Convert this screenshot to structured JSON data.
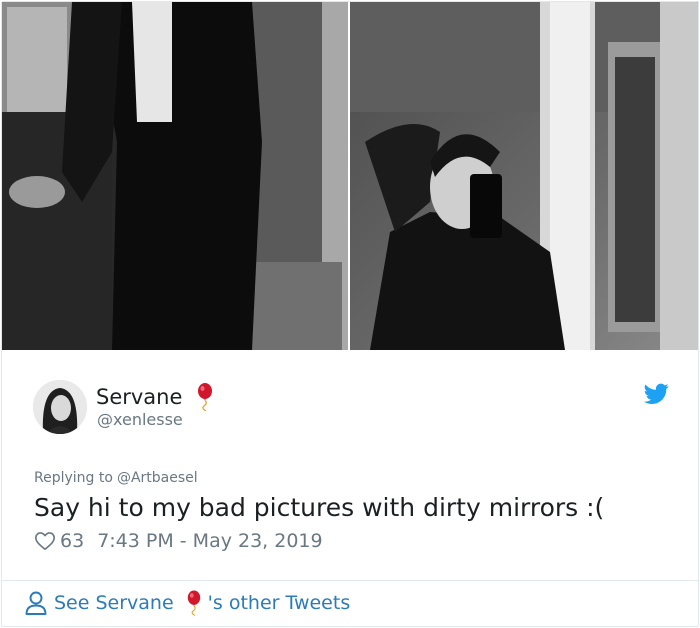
{
  "tweet": {
    "display_name": "Servane",
    "handle": "@xenlesse",
    "reply_prefix": "Replying to",
    "reply_to": "@Artbaesel",
    "text": "Say hi to my bad pictures with dirty mirrors :(",
    "like_count": "63",
    "timestamp": "7:43 PM - May 23, 2019"
  },
  "footer": {
    "see_label": "See Servane",
    "other_label": "'s other Tweets"
  },
  "icons": {
    "bird": "twitter-bird-icon",
    "heart": "heart-outline-icon",
    "person": "person-outline-icon",
    "balloon": "red-balloon-emoji"
  },
  "colors": {
    "link": "#2b7bb9",
    "twitter_blue": "#1da1f2",
    "muted": "#697882",
    "text": "#1c2022",
    "balloon": "#d0172c"
  }
}
